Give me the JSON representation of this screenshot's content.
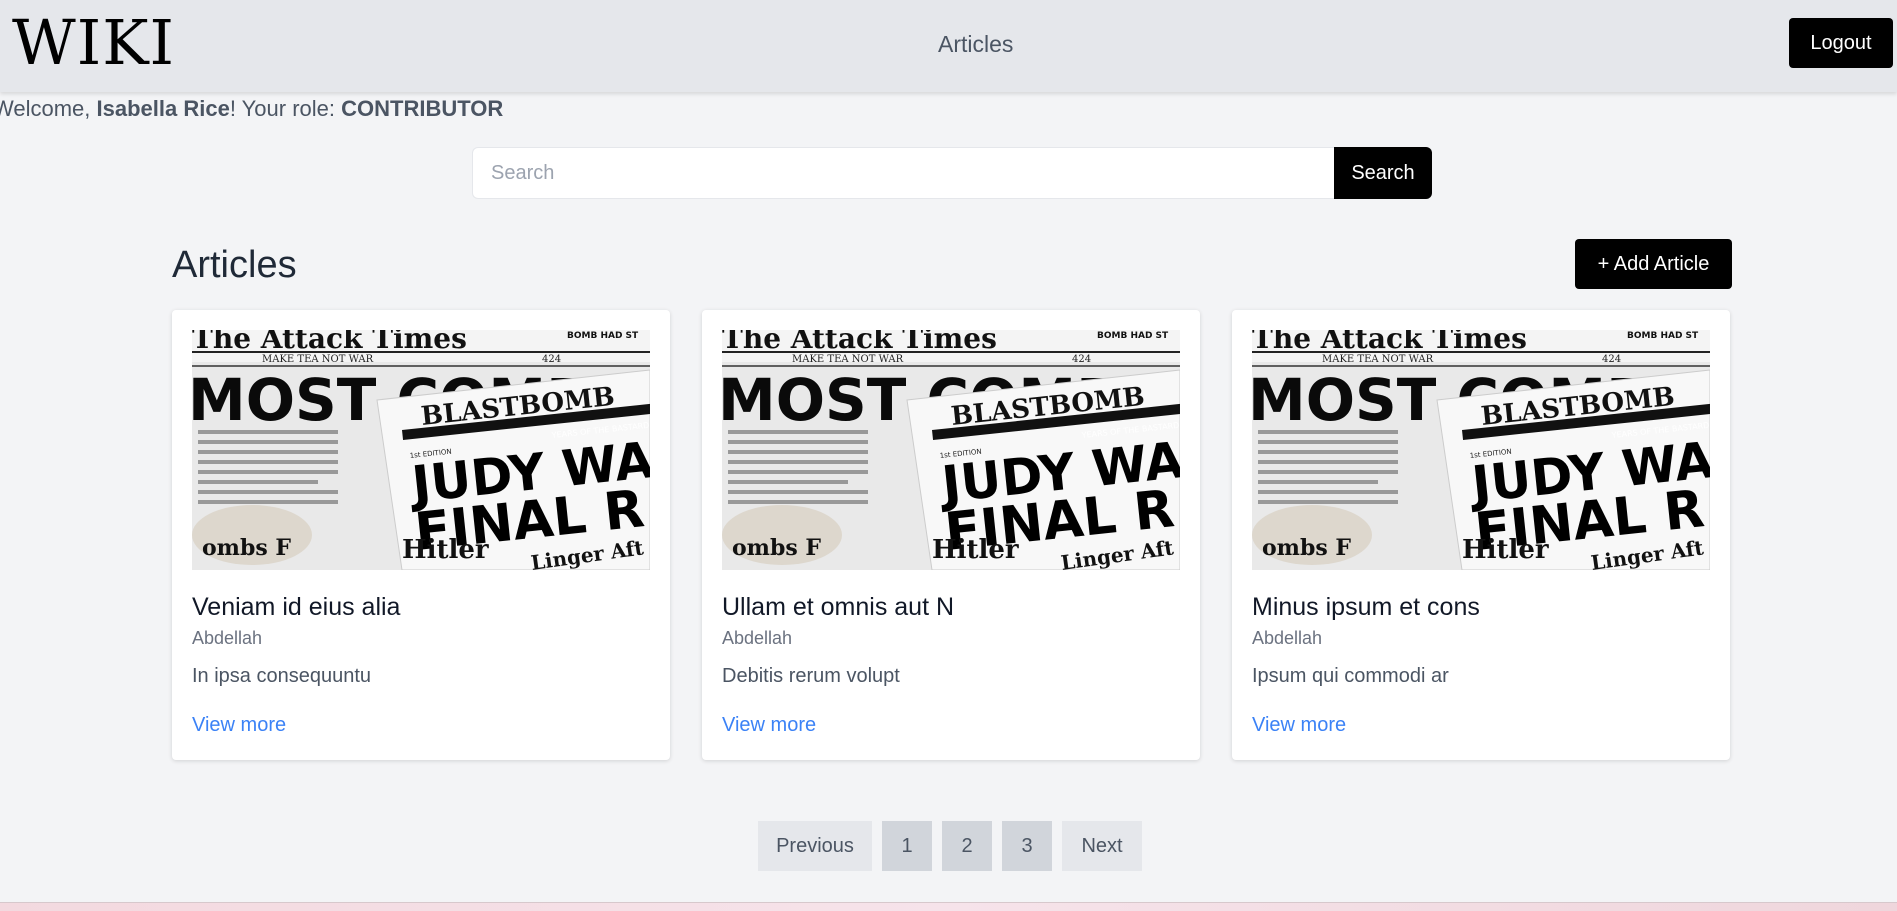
{
  "header": {
    "logo": "WIKI",
    "nav_link": "Articles",
    "logout_label": "Logout"
  },
  "welcome": {
    "prefix": "Welcome, ",
    "user_name": "Isabella Rice",
    "middle": "! Your role: ",
    "role": "CONTRIBUTOR"
  },
  "search": {
    "placeholder": "Search",
    "value": "",
    "button_label": "Search"
  },
  "main": {
    "title": "Articles",
    "add_label": "+ Add Article",
    "cards": [
      {
        "title": "Veniam id eius alia",
        "author": "Abdellah",
        "excerpt": "In ipsa consequuntu",
        "link": "View more"
      },
      {
        "title": "Ullam et omnis aut N",
        "author": "Abdellah",
        "excerpt": "Debitis rerum volupt",
        "link": "View more"
      },
      {
        "title": "Minus ipsum et cons",
        "author": "Abdellah",
        "excerpt": "Ipsum qui commodi ar",
        "link": "View more"
      }
    ],
    "card_image_text": {
      "masthead": "The Attack Times",
      "headline": "MOST COMPL",
      "brand": "BLASTBOMB",
      "years": "YEARS OF THE BASTARD",
      "edition": "1st EDITION",
      "motto": "MAKE TEA NOT WAR",
      "page": "424",
      "big1": "JUDY WAS ST",
      "big2": "FINAL R",
      "bottom1": "Hitler",
      "bottom2": "Linger Aft",
      "bottom3": "ombs F",
      "corner": "BOMB HAD ST"
    }
  },
  "pagination": {
    "previous": "Previous",
    "pages": [
      "1",
      "2",
      "3"
    ],
    "next": "Next"
  }
}
